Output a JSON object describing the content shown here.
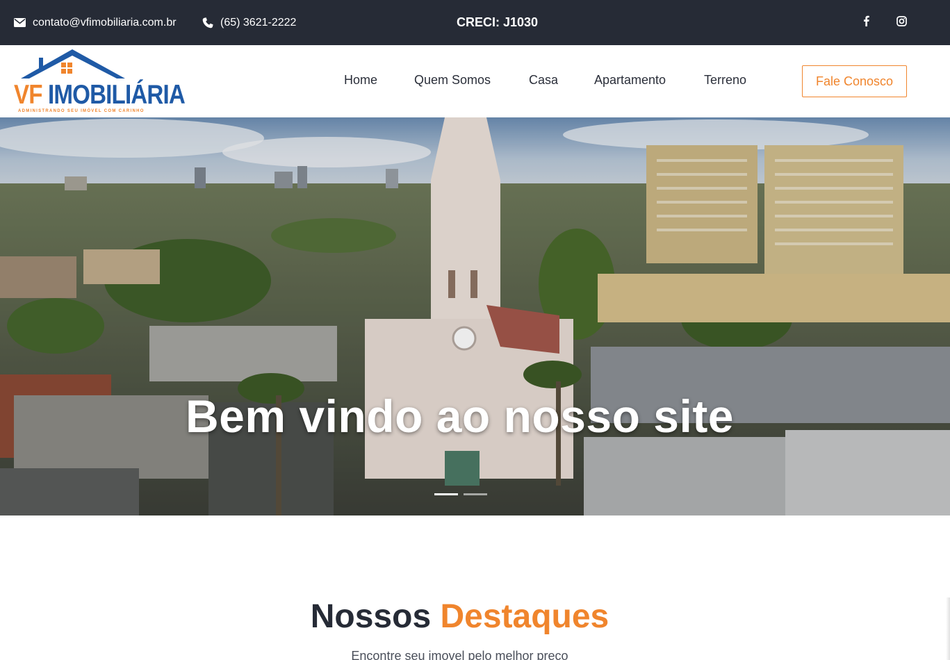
{
  "topbar": {
    "email": "contato@vfimobiliaria.com.br",
    "phone": "(65) 3621-2222",
    "creci": "CRECI: J1030",
    "icons": [
      "envelope-icon",
      "phone-icon",
      "facebook-icon",
      "instagram-icon"
    ]
  },
  "header": {
    "logo": {
      "vf": "VF",
      "name": "IMOBILIÁRIA",
      "tagline": "ADMINISTRANDO SEU IMÓVEL COM CARINHO"
    },
    "nav": [
      "Home",
      "Quem Somos",
      "Casa",
      "Apartamento",
      "Terreno"
    ],
    "cta_label": "Fale Conosco"
  },
  "hero": {
    "title": "Bem vindo ao nosso site",
    "slides": 2,
    "active_slide": 1
  },
  "highlights": {
    "title_part1": "Nossos",
    "title_part2": "Destaques",
    "subtitle": "Encontre seu imovel pelo melhor preço"
  },
  "colors": {
    "topbar_bg": "#262b36",
    "accent": "#f0852d",
    "brand_blue": "#1f5aa6",
    "text_dark": "#262b36"
  }
}
